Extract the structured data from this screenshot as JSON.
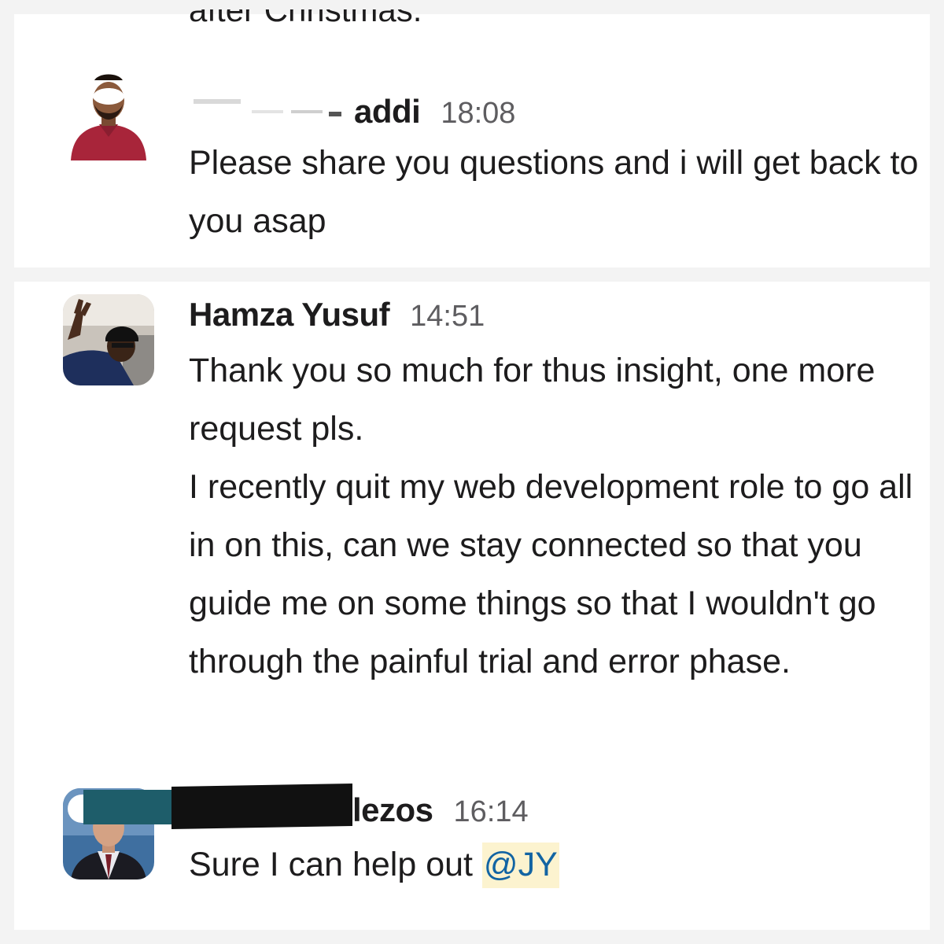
{
  "messages": [
    {
      "name": "addi",
      "time": "18:08",
      "lines": [
        "Please share you questions and i will get back to you asap"
      ]
    },
    {
      "name": "Hamza Yusuf",
      "time": "14:51",
      "lines": [
        "Thank you so much for thus insight, one more request pls.",
        "I recently quit my web development role to go all in on this, can we stay connected so that you guide me on some things so that I wouldn't go through the painful trial and error phase."
      ]
    },
    {
      "name": "lezos",
      "time": "16:14",
      "text_before_mention": "Sure I can help out ",
      "mention": "@JY"
    }
  ],
  "cut_off_text": "after Christmas.",
  "colors": {
    "background": "#f3f3f3",
    "message_bg": "#ffffff",
    "mention_text": "#1264a3",
    "mention_bg": "#fcf3cf",
    "timestamp": "#5e5d60"
  }
}
